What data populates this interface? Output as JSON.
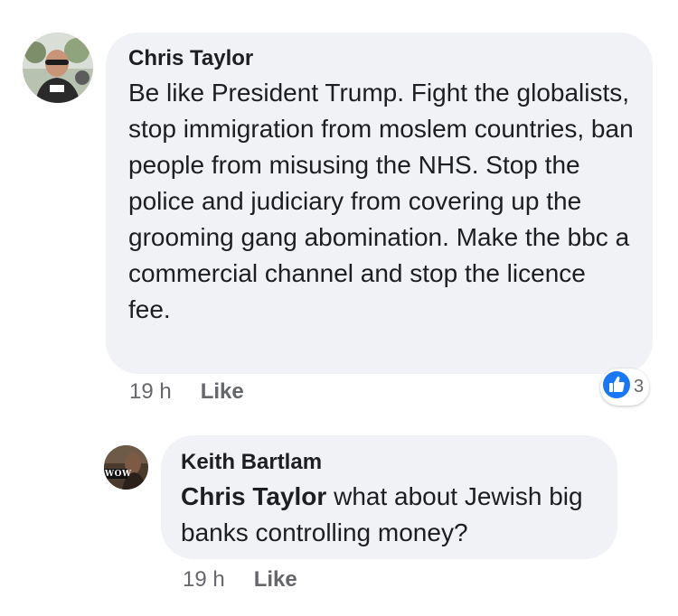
{
  "comments": [
    {
      "author": "Chris Taylor",
      "text": "Be like President Trump. Fight the globalists, stop immigration from moslem countries, ban people from misusing the NHS. Stop the police and judiciary from covering up the grooming gang abomination. Make the bbc a commercial channel and stop the licence fee.",
      "time": "19 h",
      "like_label": "Like",
      "reaction_icon": "like-thumb-icon",
      "reaction_count": "3"
    }
  ],
  "replies": [
    {
      "author": "Keith Bartlam",
      "mention": "Chris Taylor",
      "text": " what about Jewish big banks controlling money?",
      "time": "19 h",
      "like_label": "Like",
      "avatar_logo_text": "WOW"
    }
  ],
  "colors": {
    "bubble": "#f0f2f5",
    "meta_text": "#65676b",
    "like_blue": "#1877f2"
  }
}
